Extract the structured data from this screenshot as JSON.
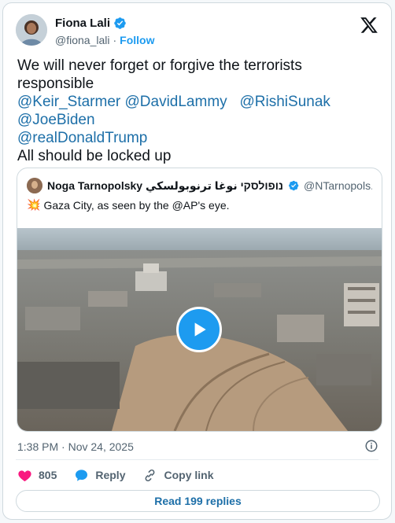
{
  "author": {
    "display_name": "Fiona Lali",
    "handle": "@fiona_lali",
    "separator": "·",
    "follow_label": "Follow"
  },
  "tweet": {
    "line1": "We will never forget or forgive the terrorists responsible",
    "mentions_row1": [
      "@Keir_Starmer",
      "@DavidLammy",
      "@RishiSunak",
      "@JoeBiden"
    ],
    "mentions_row2": [
      "@realDonaldTrump"
    ],
    "line3": "All should be locked up"
  },
  "quote": {
    "display_name": "Noga Tarnopolsky טרנופולסקי نوغا ترنوبولسكي ...",
    "handle": "@NTarnopols...",
    "emoji": "💥",
    "text": "Gaza City, as seen by the @AP's eye."
  },
  "meta": {
    "timestamp": "1:38 PM · Nov 24, 2025"
  },
  "actions": {
    "likes": "805",
    "reply_label": "Reply",
    "copy_link_label": "Copy link"
  },
  "replies_button_label": "Read 199 replies",
  "colors": {
    "link_blue": "#1d6fa8",
    "brand_blue": "#1d9bf0",
    "like_red": "#f91880",
    "muted": "#536471"
  }
}
